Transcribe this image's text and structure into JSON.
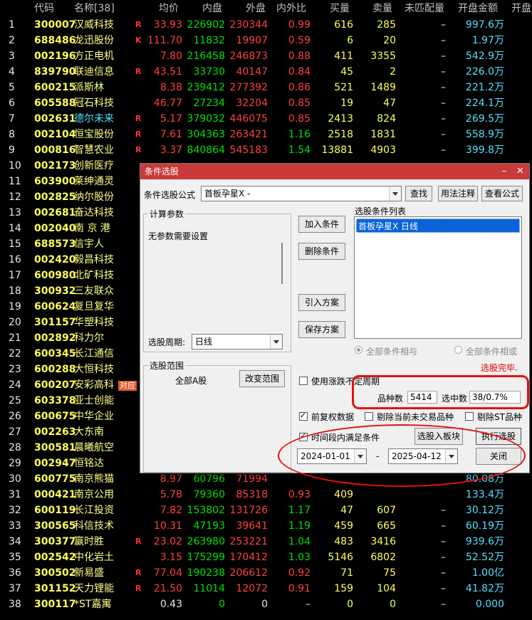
{
  "header": {
    "code": "代码",
    "name": "名称[38]",
    "avg_price": "均价",
    "inner": "内盘",
    "outer": "外盘",
    "ratio": "内外比",
    "buy": "买量",
    "sell": "卖量",
    "unmatched": "未匹配量",
    "open_amount": "开盘金额",
    "open_more": "开盘"
  },
  "rows": [
    {
      "no": "1",
      "code": "300007",
      "name": "汉威科技",
      "mark": "R",
      "avg": "33.93",
      "inner": "226902",
      "outer": "230344",
      "ratio": "0.99",
      "buy": "616",
      "sell": "285",
      "unm": "–",
      "amount": "997.6万"
    },
    {
      "no": "2",
      "code": "688486",
      "name": "龙迅股份",
      "mark": "K",
      "avg": "111.70",
      "inner": "11832",
      "outer": "19907",
      "ratio": "0.59",
      "buy": "6",
      "sell": "20",
      "unm": "–",
      "amount": "1.97万"
    },
    {
      "no": "3",
      "code": "002196",
      "name": "方正电机",
      "mark": "",
      "avg": "7.80",
      "inner": "216458",
      "outer": "246873",
      "ratio": "0.88",
      "buy": "411",
      "sell": "3355",
      "unm": "–",
      "amount": "542.9万"
    },
    {
      "no": "4",
      "code": "839790",
      "name": "联迪信息",
      "mark": "R",
      "avg": "43.51",
      "inner": "33730",
      "outer": "40147",
      "ratio": "0.84",
      "buy": "45",
      "sell": "2",
      "unm": "–",
      "amount": "226.0万"
    },
    {
      "no": "5",
      "code": "600215",
      "name": "派斯林",
      "mark": "",
      "avg": "8.38",
      "inner": "239412",
      "outer": "277392",
      "ratio": "0.86",
      "buy": "521",
      "sell": "1489",
      "unm": "–",
      "amount": "221.2万"
    },
    {
      "no": "6",
      "code": "605588",
      "name": "冠石科技",
      "mark": "",
      "avg": "46.77",
      "inner": "27234",
      "outer": "32204",
      "ratio": "0.85",
      "buy": "19",
      "sell": "47",
      "unm": "–",
      "amount": "224.1万"
    },
    {
      "no": "7",
      "code": "002631",
      "name": "德尔未来",
      "mark": "R",
      "avg": "5.17",
      "inner": "379032",
      "outer": "446075",
      "ratio": "0.85",
      "buy": "2413",
      "sell": "824",
      "unm": "–",
      "amount": "269.5万"
    },
    {
      "no": "8",
      "code": "002104",
      "name": "恒宝股份",
      "mark": "R",
      "avg": "7.61",
      "inner": "304363",
      "outer": "263421",
      "ratio": "1.16",
      "buy": "2518",
      "sell": "1831",
      "unm": "–",
      "amount": "558.9万"
    },
    {
      "no": "9",
      "code": "000816",
      "name": "智慧农业",
      "mark": "R",
      "avg": "3.37",
      "inner": "840864",
      "outer": "545183",
      "ratio": "1.54",
      "buy": "13881",
      "sell": "4903",
      "unm": "–",
      "amount": "399.8万"
    },
    {
      "no": "10",
      "code": "002173",
      "name": "创新医疗",
      "mark": "",
      "avg": "",
      "inner": "",
      "outer": "",
      "ratio": "",
      "buy": "",
      "sell": "",
      "unm": "",
      "amount": ""
    },
    {
      "no": "11",
      "code": "603900",
      "name": "莱绅通灵",
      "mark": "",
      "avg": "",
      "inner": "",
      "outer": "",
      "ratio": "",
      "buy": "",
      "sell": "",
      "unm": "",
      "amount": ""
    },
    {
      "no": "12",
      "code": "002825",
      "name": "纳尔股份",
      "mark": "",
      "avg": "",
      "inner": "",
      "outer": "",
      "ratio": "",
      "buy": "",
      "sell": "",
      "unm": "",
      "amount": ""
    },
    {
      "no": "13",
      "code": "002681",
      "name": "奋达科技",
      "mark": "",
      "avg": "",
      "inner": "",
      "outer": "",
      "ratio": "",
      "buy": "",
      "sell": "",
      "unm": "",
      "amount": ""
    },
    {
      "no": "14",
      "code": "002040",
      "name": "南 京 港",
      "mark": "",
      "avg": "",
      "inner": "",
      "outer": "",
      "ratio": "",
      "buy": "",
      "sell": "",
      "unm": "",
      "amount": ""
    },
    {
      "no": "15",
      "code": "688573",
      "name": "信宇人",
      "mark": "",
      "avg": "",
      "inner": "",
      "outer": "",
      "ratio": "",
      "buy": "",
      "sell": "",
      "unm": "",
      "amount": ""
    },
    {
      "no": "16",
      "code": "002420",
      "name": "毅昌科技",
      "mark": "",
      "avg": "",
      "inner": "",
      "outer": "",
      "ratio": "",
      "buy": "",
      "sell": "",
      "unm": "",
      "amount": ""
    },
    {
      "no": "17",
      "code": "600980",
      "name": "北矿科技",
      "mark": "",
      "avg": "",
      "inner": "",
      "outer": "",
      "ratio": "",
      "buy": "",
      "sell": "",
      "unm": "",
      "amount": ""
    },
    {
      "no": "18",
      "code": "300932",
      "name": "三友联众",
      "mark": "",
      "avg": "",
      "inner": "",
      "outer": "",
      "ratio": "",
      "buy": "",
      "sell": "",
      "unm": "",
      "amount": ""
    },
    {
      "no": "19",
      "code": "600624",
      "name": "复旦复华",
      "mark": "",
      "avg": "",
      "inner": "",
      "outer": "",
      "ratio": "",
      "buy": "",
      "sell": "",
      "unm": "",
      "amount": ""
    },
    {
      "no": "20",
      "code": "301157",
      "name": "华塑科技",
      "mark": "",
      "avg": "",
      "inner": "",
      "outer": "",
      "ratio": "",
      "buy": "",
      "sell": "",
      "unm": "",
      "amount": ""
    },
    {
      "no": "21",
      "code": "002892",
      "name": "科力尔",
      "mark": "",
      "avg": "",
      "inner": "",
      "outer": "",
      "ratio": "",
      "buy": "",
      "sell": "",
      "unm": "",
      "amount": ""
    },
    {
      "no": "22",
      "code": "600345",
      "name": "长江通信",
      "mark": "",
      "avg": "",
      "inner": "",
      "outer": "",
      "ratio": "",
      "buy": "",
      "sell": "",
      "unm": "",
      "amount": ""
    },
    {
      "no": "23",
      "code": "600288",
      "name": "大恒科技",
      "mark": "",
      "avg": "",
      "inner": "",
      "outer": "",
      "ratio": "",
      "buy": "",
      "sell": "",
      "unm": "",
      "amount": ""
    },
    {
      "no": "24",
      "code": "600207",
      "name": "安彩高科",
      "mark": "",
      "avg": "",
      "inner": "",
      "outer": "",
      "ratio": "",
      "buy": "",
      "sell": "",
      "unm": "",
      "amount": ""
    },
    {
      "no": "25",
      "code": "603378",
      "name": "亚士创能",
      "mark": "",
      "avg": "",
      "inner": "",
      "outer": "",
      "ratio": "",
      "buy": "",
      "sell": "",
      "unm": "",
      "amount": ""
    },
    {
      "no": "26",
      "code": "600675",
      "name": "中华企业",
      "mark": "",
      "avg": "",
      "inner": "",
      "outer": "",
      "ratio": "",
      "buy": "",
      "sell": "",
      "unm": "",
      "amount": ""
    },
    {
      "no": "27",
      "code": "002263",
      "name": "大东南",
      "mark": "",
      "avg": "",
      "inner": "",
      "outer": "",
      "ratio": "",
      "buy": "",
      "sell": "",
      "unm": "",
      "amount": ""
    },
    {
      "no": "28",
      "code": "300581",
      "name": "晨曦航空",
      "mark": "",
      "avg": "",
      "inner": "",
      "outer": "",
      "ratio": "",
      "buy": "",
      "sell": "",
      "unm": "",
      "amount": ""
    },
    {
      "no": "29",
      "code": "002947",
      "name": "恒铭达",
      "mark": "",
      "avg": "",
      "inner": "",
      "outer": "",
      "ratio": "",
      "buy": "",
      "sell": "",
      "unm": "",
      "amount": ""
    },
    {
      "no": "30",
      "code": "600775",
      "name": "南京熊猫",
      "mark": "",
      "avg": "8.97",
      "inner": "60796",
      "outer": "71994",
      "ratio": "",
      "buy": "",
      "sell": "",
      "unm": "",
      "amount": "80.08万"
    },
    {
      "no": "31",
      "code": "000421",
      "name": "南京公用",
      "mark": "",
      "avg": "5.78",
      "inner": "79360",
      "outer": "85318",
      "ratio": "0.93",
      "buy": "409",
      "sell": "",
      "unm": "",
      "amount": "133.4万"
    },
    {
      "no": "32",
      "code": "600119",
      "name": "长江投资",
      "mark": "",
      "avg": "7.82",
      "inner": "153802",
      "outer": "131726",
      "ratio": "1.17",
      "buy": "47",
      "sell": "607",
      "unm": "–",
      "amount": "30.12万"
    },
    {
      "no": "33",
      "code": "300565",
      "name": "科信技术",
      "mark": "",
      "avg": "10.31",
      "inner": "47193",
      "outer": "39641",
      "ratio": "1.19",
      "buy": "459",
      "sell": "665",
      "unm": "–",
      "amount": "60.19万"
    },
    {
      "no": "34",
      "code": "300377",
      "name": "赢时胜",
      "mark": "R",
      "avg": "23.02",
      "inner": "263980",
      "outer": "253221",
      "ratio": "1.04",
      "buy": "483",
      "sell": "3416",
      "unm": "–",
      "amount": "939.6万"
    },
    {
      "no": "35",
      "code": "002542",
      "name": "中化岩土",
      "mark": "",
      "avg": "3.15",
      "inner": "175299",
      "outer": "170412",
      "ratio": "1.03",
      "buy": "5146",
      "sell": "6802",
      "unm": "–",
      "amount": "52.52万"
    },
    {
      "no": "36",
      "code": "300502",
      "name": "新易盛",
      "mark": "R",
      "avg": "77.04",
      "inner": "190238",
      "outer": "206612",
      "ratio": "0.92",
      "buy": "71",
      "sell": "75",
      "unm": "–",
      "amount": "1.00亿"
    },
    {
      "no": "37",
      "code": "301152",
      "name": "天力锂能",
      "mark": "R",
      "avg": "21.50",
      "inner": "11014",
      "outer": "12072",
      "ratio": "0.91",
      "buy": "159",
      "sell": "104",
      "unm": "–",
      "amount": "41.82万"
    },
    {
      "no": "38",
      "code": "300117",
      "name": "*ST嘉寓",
      "mark": "",
      "avg": "0.43",
      "inner": "0",
      "outer": "0",
      "ratio": "–",
      "buy": "0",
      "sell": "0",
      "unm": "–",
      "amount": "0.000"
    }
  ],
  "side_tag": "对应",
  "dialog": {
    "title": "条件选股",
    "formula_label": "条件选股公式",
    "formula_value": "首板孕星X  -",
    "find_btn": "查找",
    "usage_btn": "用法注释",
    "view_btn": "查看公式",
    "params_title": "计算参数",
    "params_text": "无参数需要设置",
    "add_btn": "加入条件",
    "del_btn": "删除条件",
    "list_title": "选股条件列表",
    "list_item": "首板孕星X  日线",
    "import_btn": "引入方案",
    "save_btn": "保存方案",
    "period_label": "选股周期:",
    "period_value": "日线",
    "radio_and": "全部条件相与",
    "radio_or": "全部条件相或",
    "done_text": "选股完毕.",
    "scope_title": "选股范围",
    "scope_value": "全部A股",
    "change_scope_btn": "改变范围",
    "use_period_label": "使用涨跌不定周期",
    "count_label": "品种数",
    "count_value": "5414",
    "selected_label": "选中数",
    "selected_value": "38/0.7%",
    "forward_label": "前复权数据",
    "exclude_untraded_label": "剔除当前未交易品种",
    "exclude_st_label": "剔除ST品种",
    "time_range_label": "时间段内满足条件",
    "into_block_btn": "选股入板块",
    "exec_btn": "执行选股",
    "date_from": "2024-01-01",
    "date_sep": "-",
    "date_to": "2025-04-12",
    "close_btn": "关闭"
  }
}
